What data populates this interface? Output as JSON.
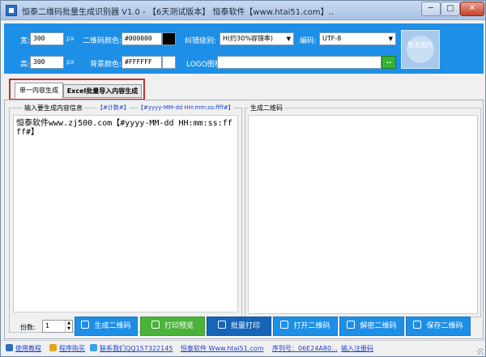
{
  "window": {
    "title": "恒泰二维码批量生成识别器 V1.0 - 【6天测试版本】 恒泰软件【www.htai51.com】..",
    "min_label": "─",
    "max_label": "□",
    "close_label": "✕"
  },
  "settings": {
    "width_label": "宽:",
    "width_value": "300",
    "width_unit": "px",
    "height_label": "高:",
    "height_value": "300",
    "height_unit": "px",
    "qr_color_label": "二维码颜色:",
    "qr_color_value": "#000000",
    "qr_color": "#000000",
    "bg_color_label": "背景颜色:",
    "bg_color_value": "#FFFFFF",
    "bg_color": "#FFFFFF",
    "ecc_label": "纠错级别:",
    "ecc_value": "H(约30%容错率)",
    "encoding_label": "编码:",
    "encoding_value": "UTF-8",
    "logo_label": "LOGO图标:",
    "logo_value": "",
    "browse_label": "..",
    "preview_text": "暂无图片"
  },
  "tabs": [
    {
      "label": "单一内容生成",
      "active": true
    },
    {
      "label": "Excel批量导入内容生成",
      "active": false
    }
  ],
  "input_group": {
    "title": "输入要生成内容信息",
    "link_counter": "【#计数#】",
    "link_datetime": "【#yyyy-MM-dd HH:mm:ss:ffff#】",
    "content": "恒泰软件www.zj500.com【#yyyy-MM-dd HH:mm:ss:ffff#】"
  },
  "output_group": {
    "title": "生成二维码"
  },
  "copies": {
    "label": "份数:",
    "value": "1"
  },
  "actions": {
    "generate": "生成二维码",
    "print_preview": "打印预览",
    "batch_print": "批量打印",
    "open": "打开二维码",
    "decode": "解密二维码",
    "save": "保存二维码"
  },
  "statusbar": {
    "tutorial": "使用教程",
    "buy": "程序购买",
    "contact": "联系我们QQ157322145",
    "site": "恒泰软件 Www.htai51.com",
    "serial": "序列号：06E24A80...",
    "register": "输入注册码"
  },
  "colors": {
    "accent": "#1e8fe6",
    "highlight": "#c0332b",
    "green": "#4cb33a"
  }
}
